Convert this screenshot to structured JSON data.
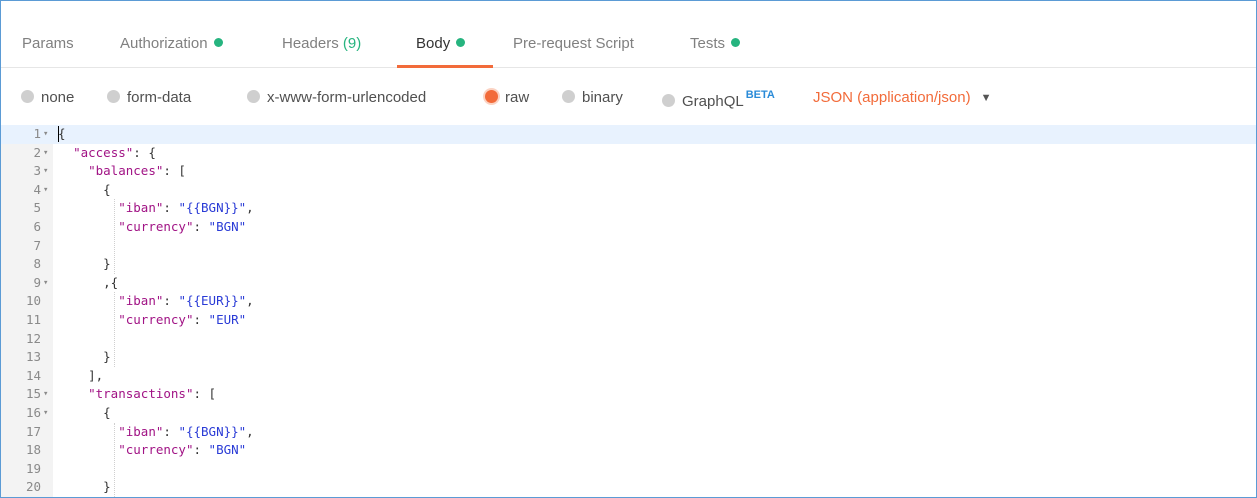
{
  "tabs": [
    {
      "label": "Params",
      "count": "",
      "dot": false
    },
    {
      "label": "Authorization",
      "count": "",
      "dot": true
    },
    {
      "label": "Headers",
      "count": "(9)",
      "dot": false
    },
    {
      "label": "Body",
      "count": "",
      "dot": true,
      "active": true
    },
    {
      "label": "Pre-request Script",
      "count": "",
      "dot": false
    },
    {
      "label": "Tests",
      "count": "",
      "dot": true
    }
  ],
  "body_types": [
    {
      "label": "none",
      "selected": false
    },
    {
      "label": "form-data",
      "selected": false
    },
    {
      "label": "x-www-form-urlencoded",
      "selected": false
    },
    {
      "label": "raw",
      "selected": true
    },
    {
      "label": "binary",
      "selected": false
    },
    {
      "label": "GraphQL",
      "badge": "BETA",
      "selected": false
    }
  ],
  "content_type": "JSON (application/json)",
  "colors": {
    "accent": "#f26b3a",
    "status_dot": "#26b47f",
    "beta": "#2a8bd8",
    "json_key": "#a11385",
    "json_string": "#2a3bd6"
  },
  "editor": {
    "lines": [
      {
        "n": "1",
        "fold": true,
        "text": "{"
      },
      {
        "n": "2",
        "fold": true,
        "text": "  \"access\": {"
      },
      {
        "n": "3",
        "fold": true,
        "text": "    \"balances\": ["
      },
      {
        "n": "4",
        "fold": true,
        "text": "      {"
      },
      {
        "n": "5",
        "fold": false,
        "text": "        \"iban\": \"{{BGN}}\","
      },
      {
        "n": "6",
        "fold": false,
        "text": "        \"currency\": \"BGN\""
      },
      {
        "n": "7",
        "fold": false,
        "text": ""
      },
      {
        "n": "8",
        "fold": false,
        "text": "      }"
      },
      {
        "n": "9",
        "fold": true,
        "text": "      ,{"
      },
      {
        "n": "10",
        "fold": false,
        "text": "        \"iban\": \"{{EUR}}\","
      },
      {
        "n": "11",
        "fold": false,
        "text": "        \"currency\": \"EUR\""
      },
      {
        "n": "12",
        "fold": false,
        "text": ""
      },
      {
        "n": "13",
        "fold": false,
        "text": "      }"
      },
      {
        "n": "14",
        "fold": false,
        "text": "    ],"
      },
      {
        "n": "15",
        "fold": true,
        "text": "    \"transactions\": ["
      },
      {
        "n": "16",
        "fold": true,
        "text": "      {"
      },
      {
        "n": "17",
        "fold": false,
        "text": "        \"iban\": \"{{BGN}}\","
      },
      {
        "n": "18",
        "fold": false,
        "text": "        \"currency\": \"BGN\""
      },
      {
        "n": "19",
        "fold": false,
        "text": ""
      },
      {
        "n": "20",
        "fold": false,
        "text": "      }"
      }
    ]
  }
}
